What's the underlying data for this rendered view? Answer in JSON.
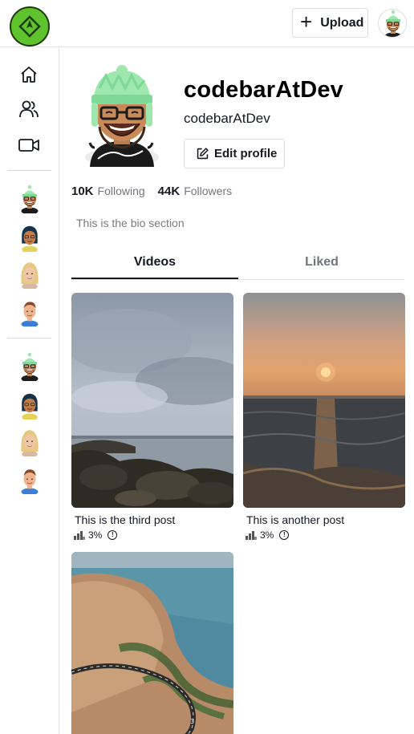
{
  "header": {
    "logo_icon": "diamond-arrow-logo-icon",
    "upload_label": "Upload",
    "upload_icon": "plus-icon",
    "avatar": "user-avatar"
  },
  "sidebar": {
    "nav": [
      {
        "name": "home-icon"
      },
      {
        "name": "following-icon"
      },
      {
        "name": "live-video-icon"
      }
    ],
    "suggested_accounts": [
      "avatar-green-beanie",
      "avatar-dark-hair",
      "avatar-blonde",
      "avatar-man"
    ],
    "following_accounts": [
      "avatar-green-beanie",
      "avatar-dark-hair",
      "avatar-blonde",
      "avatar-man"
    ]
  },
  "profile": {
    "username": "codebarAtDev",
    "display_name": "codebarAtDev",
    "edit_label": "Edit profile",
    "following_count": "10K",
    "following_label": "Following",
    "followers_count": "44K",
    "followers_label": "Followers",
    "bio": "This is the bio section"
  },
  "tabs": {
    "videos": "Videos",
    "liked": "Liked",
    "active": "Videos"
  },
  "videos": [
    {
      "caption": "This is the third post",
      "stat": "3%",
      "thumb": "cloudy-rocky-shore"
    },
    {
      "caption": "This is another post",
      "stat": "3%",
      "thumb": "sunset-sea"
    },
    {
      "caption": "",
      "stat": "",
      "thumb": "coastal-cliff-road"
    }
  ],
  "colors": {
    "logo_green": "#5ec32d",
    "text": "#161823",
    "muted": "#73757c",
    "border": "#e3e3e4"
  }
}
